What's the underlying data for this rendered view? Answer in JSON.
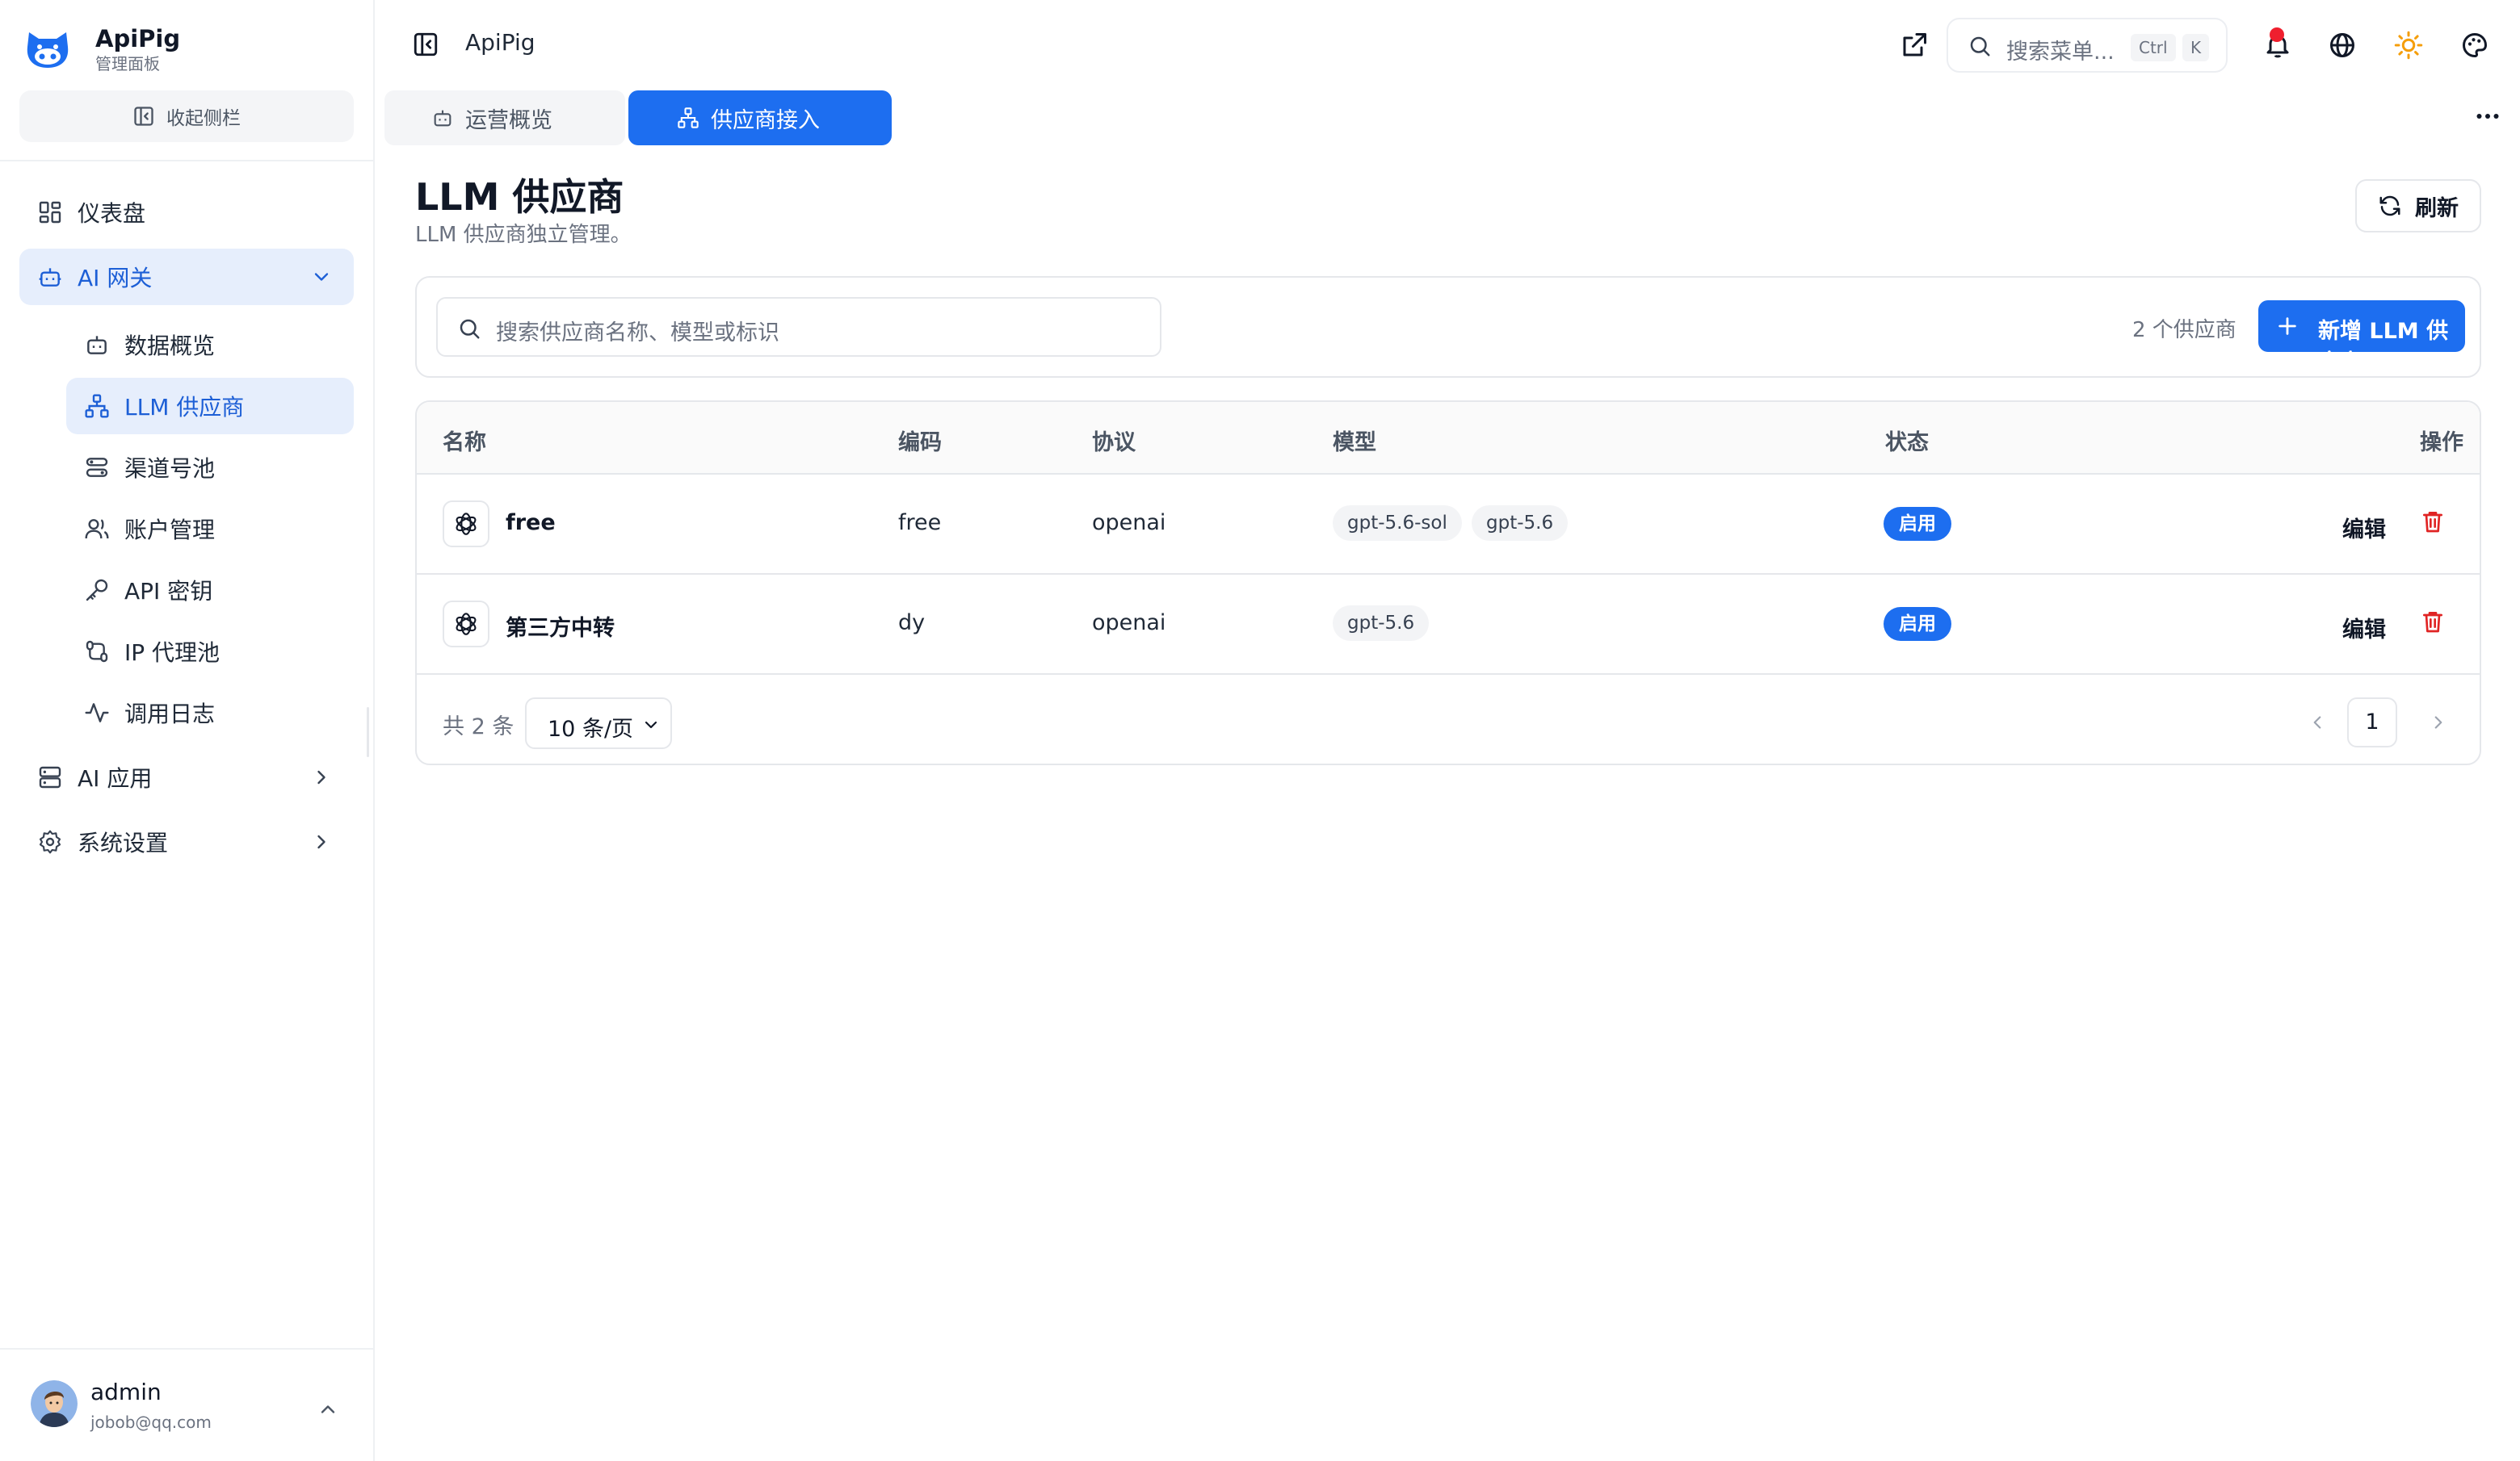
{
  "brand": {
    "name": "ApiPig",
    "subtitle": "管理面板"
  },
  "sidebar": {
    "collapse_label": "收起侧栏",
    "items": [
      {
        "label": "仪表盘",
        "icon": "dashboard-icon"
      },
      {
        "label": "AI 网关",
        "icon": "bot-icon",
        "expanded": true
      },
      {
        "label": "AI 应用",
        "icon": "server-icon"
      },
      {
        "label": "系统设置",
        "icon": "gear-icon"
      }
    ],
    "sub_items": [
      {
        "label": "数据概览",
        "icon": "bot-icon"
      },
      {
        "label": "LLM 供应商",
        "icon": "network-icon",
        "active": true
      },
      {
        "label": "渠道号池",
        "icon": "filter-icon"
      },
      {
        "label": "账户管理",
        "icon": "users-icon"
      },
      {
        "label": "API 密钥",
        "icon": "key-icon"
      },
      {
        "label": "IP 代理池",
        "icon": "route-icon"
      },
      {
        "label": "调用日志",
        "icon": "activity-icon"
      }
    ]
  },
  "user": {
    "name": "admin",
    "email": "jobob@qq.com"
  },
  "header": {
    "title": "ApiPig",
    "search_placeholder": "搜索菜单...",
    "shortcut_mod": "Ctrl",
    "shortcut_key": "K"
  },
  "tabs": [
    {
      "label": "运营概览",
      "active": false
    },
    {
      "label": "供应商接入",
      "active": true
    }
  ],
  "page": {
    "title": "LLM 供应商",
    "subtitle": "LLM 供应商独立管理。",
    "refresh_label": "刷新",
    "search_placeholder": "搜索供应商名称、模型或标识",
    "count_text": "2 个供应商",
    "add_label": "新增 LLM 供应商"
  },
  "table": {
    "columns": [
      "名称",
      "编码",
      "协议",
      "模型",
      "状态",
      "操作"
    ],
    "rows": [
      {
        "name": "free",
        "code": "free",
        "protocol": "openai",
        "models": [
          "gpt-5.6-sol",
          "gpt-5.6"
        ],
        "status": "启用",
        "action": "编辑"
      },
      {
        "name": "第三方中转",
        "code": "dy",
        "protocol": "openai",
        "models": [
          "gpt-5.6"
        ],
        "status": "启用",
        "action": "编辑"
      }
    ]
  },
  "pagination": {
    "total_text": "共 2 条",
    "page_size": "10 条/页",
    "current_page": "1"
  },
  "colors": {
    "accent": "#1d6ef0",
    "active_bg": "#e6eefc",
    "danger": "#e02424",
    "notification": "#ef1f2e",
    "sun": "#f59e0b"
  }
}
